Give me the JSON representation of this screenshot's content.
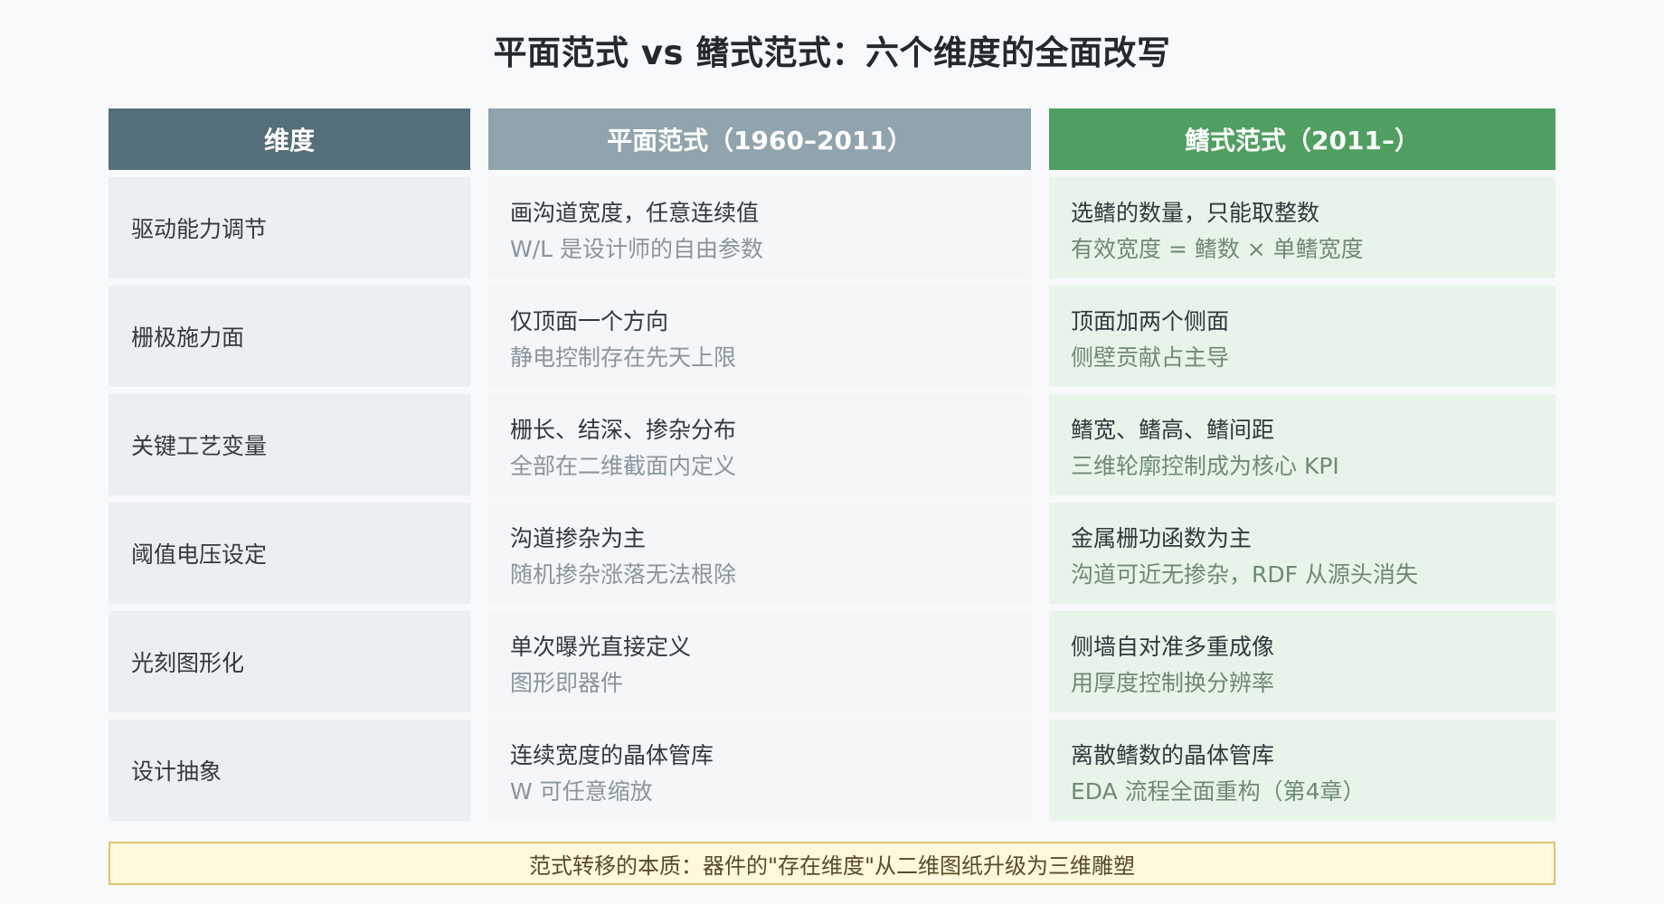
{
  "title": "平面范式 vs 鳍式范式：六个维度的全面改写",
  "headers": {
    "dimension": "维度",
    "planar": "平面范式（1960–2011）",
    "finfet": "鳍式范式（2011–）"
  },
  "rows": [
    {
      "dimension": "驱动能力调节",
      "planar_main": "画沟道宽度，任意连续值",
      "planar_sub": "W/L 是设计师的自由参数",
      "fin_main": "选鳍的数量，只能取整数",
      "fin_sub": "有效宽度 = 鳍数 × 单鳍宽度"
    },
    {
      "dimension": "栅极施力面",
      "planar_main": "仅顶面一个方向",
      "planar_sub": "静电控制存在先天上限",
      "fin_main": "顶面加两个侧面",
      "fin_sub": "侧壁贡献占主导"
    },
    {
      "dimension": "关键工艺变量",
      "planar_main": "栅长、结深、掺杂分布",
      "planar_sub": "全部在二维截面内定义",
      "fin_main": "鳍宽、鳍高、鳍间距",
      "fin_sub": "三维轮廓控制成为核心 KPI"
    },
    {
      "dimension": "阈值电压设定",
      "planar_main": "沟道掺杂为主",
      "planar_sub": "随机掺杂涨落无法根除",
      "fin_main": "金属栅功函数为主",
      "fin_sub": "沟道可近无掺杂，RDF 从源头消失"
    },
    {
      "dimension": "光刻图形化",
      "planar_main": "单次曝光直接定义",
      "planar_sub": "图形即器件",
      "fin_main": "侧墙自对准多重成像",
      "fin_sub": "用厚度控制换分辨率"
    },
    {
      "dimension": "设计抽象",
      "planar_main": "连续宽度的晶体管库",
      "planar_sub": "W 可任意缩放",
      "fin_main": "离散鳍数的晶体管库",
      "fin_sub": "EDA 流程全面重构（第4章）"
    }
  ],
  "footer": "范式转移的本质：器件的\"存在维度\"从二维图纸升级为三维雕塑",
  "colors": {
    "header_dimension": "#546e7a",
    "header_planar": "#90a4ae",
    "header_finfet": "#4f9f60",
    "footer_bg": "#fff8dd",
    "footer_border": "#e0c46c"
  }
}
